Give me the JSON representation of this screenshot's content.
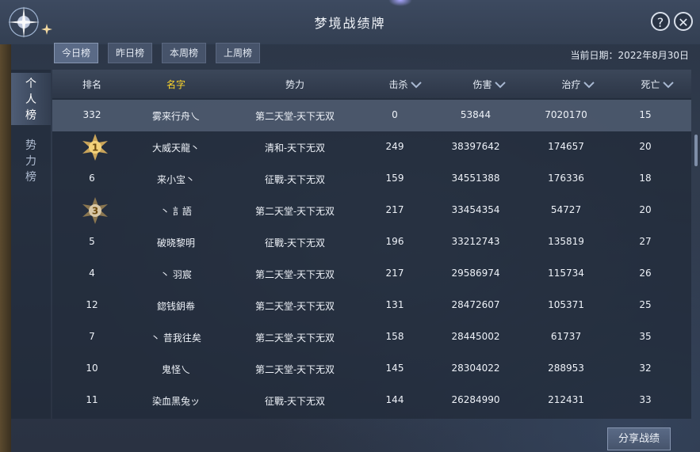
{
  "header": {
    "title": "梦境战绩牌"
  },
  "buttons": {
    "help": "?",
    "close": "✕"
  },
  "tabs": [
    "今日榜",
    "昨日榜",
    "本周榜",
    "上周榜"
  ],
  "date": {
    "label": "当前日期：",
    "value": "2022年8月30日"
  },
  "side": {
    "personal": "个人榜",
    "faction": "势力榜"
  },
  "table": {
    "headers": [
      "排名",
      "名字",
      "势力",
      "击杀",
      "伤害",
      "治疗",
      "死亡"
    ],
    "self_row": [
      "332",
      "雾来行舟乀",
      "第二天堂-天下无双",
      "0",
      "53844",
      "7020170",
      "15"
    ],
    "rows": [
      {
        "rank": "1",
        "medal": true,
        "name": "大威天龍丶",
        "faction": "清和-天下无双",
        "kills": "249",
        "damage": "38397642",
        "heal": "174657",
        "deaths": "20"
      },
      {
        "rank": "6",
        "medal": false,
        "name": "来小宝丶",
        "faction": "征戰-天下无双",
        "kills": "159",
        "damage": "34551388",
        "heal": "176336",
        "deaths": "18"
      },
      {
        "rank": "3",
        "medal": true,
        "name": "丶 訁語",
        "faction": "第二天堂-天下无双",
        "kills": "217",
        "damage": "33454354",
        "heal": "54727",
        "deaths": "20"
      },
      {
        "rank": "5",
        "medal": false,
        "name": "破晓黎明",
        "faction": "征戰-天下无双",
        "kills": "196",
        "damage": "33212743",
        "heal": "135819",
        "deaths": "27"
      },
      {
        "rank": "4",
        "medal": false,
        "name": "丶 羽宸",
        "faction": "第二天堂-天下无双",
        "kills": "217",
        "damage": "29586974",
        "heal": "115734",
        "deaths": "26"
      },
      {
        "rank": "12",
        "medal": false,
        "name": "鍃钱鈅帣",
        "faction": "第二天堂-天下无双",
        "kills": "131",
        "damage": "28472607",
        "heal": "105371",
        "deaths": "25"
      },
      {
        "rank": "7",
        "medal": false,
        "name": "丶 昔我往矣",
        "faction": "第二天堂-天下无双",
        "kills": "158",
        "damage": "28445002",
        "heal": "61737",
        "deaths": "35"
      },
      {
        "rank": "10",
        "medal": false,
        "name": "鬼怪乀",
        "faction": "第二天堂-天下无双",
        "kills": "145",
        "damage": "28304022",
        "heal": "288953",
        "deaths": "32"
      },
      {
        "rank": "11",
        "medal": false,
        "name": "染血黑兔ッ",
        "faction": "征戰-天下无双",
        "kills": "144",
        "damage": "26284990",
        "heal": "212431",
        "deaths": "33"
      }
    ]
  },
  "share": "分享战绩",
  "colors": {
    "gold": "#ffd72a",
    "accent": "#5a6a86"
  },
  "icons": [
    "star-emblem-icon",
    "help-icon",
    "close-icon",
    "sort-down-icon",
    "medal-icon"
  ]
}
